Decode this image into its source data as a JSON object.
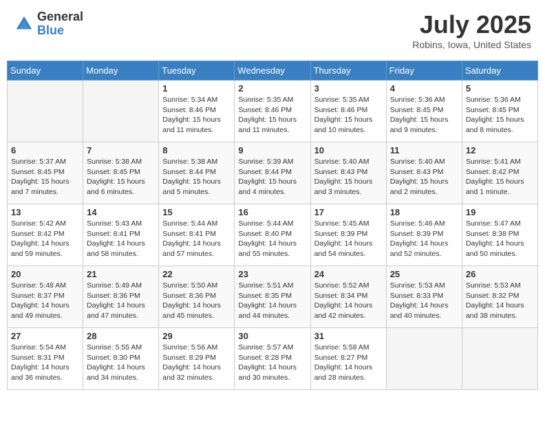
{
  "header": {
    "logo_general": "General",
    "logo_blue": "Blue",
    "title": "July 2025",
    "location": "Robins, Iowa, United States"
  },
  "days_of_week": [
    "Sunday",
    "Monday",
    "Tuesday",
    "Wednesday",
    "Thursday",
    "Friday",
    "Saturday"
  ],
  "weeks": [
    [
      {
        "day": "",
        "info": ""
      },
      {
        "day": "",
        "info": ""
      },
      {
        "day": "1",
        "info": "Sunrise: 5:34 AM\nSunset: 8:46 PM\nDaylight: 15 hours\nand 11 minutes."
      },
      {
        "day": "2",
        "info": "Sunrise: 5:35 AM\nSunset: 8:46 PM\nDaylight: 15 hours\nand 11 minutes."
      },
      {
        "day": "3",
        "info": "Sunrise: 5:35 AM\nSunset: 8:46 PM\nDaylight: 15 hours\nand 10 minutes."
      },
      {
        "day": "4",
        "info": "Sunrise: 5:36 AM\nSunset: 8:45 PM\nDaylight: 15 hours\nand 9 minutes."
      },
      {
        "day": "5",
        "info": "Sunrise: 5:36 AM\nSunset: 8:45 PM\nDaylight: 15 hours\nand 8 minutes."
      }
    ],
    [
      {
        "day": "6",
        "info": "Sunrise: 5:37 AM\nSunset: 8:45 PM\nDaylight: 15 hours\nand 7 minutes."
      },
      {
        "day": "7",
        "info": "Sunrise: 5:38 AM\nSunset: 8:45 PM\nDaylight: 15 hours\nand 6 minutes."
      },
      {
        "day": "8",
        "info": "Sunrise: 5:38 AM\nSunset: 8:44 PM\nDaylight: 15 hours\nand 5 minutes."
      },
      {
        "day": "9",
        "info": "Sunrise: 5:39 AM\nSunset: 8:44 PM\nDaylight: 15 hours\nand 4 minutes."
      },
      {
        "day": "10",
        "info": "Sunrise: 5:40 AM\nSunset: 8:43 PM\nDaylight: 15 hours\nand 3 minutes."
      },
      {
        "day": "11",
        "info": "Sunrise: 5:40 AM\nSunset: 8:43 PM\nDaylight: 15 hours\nand 2 minutes."
      },
      {
        "day": "12",
        "info": "Sunrise: 5:41 AM\nSunset: 8:42 PM\nDaylight: 15 hours\nand 1 minute."
      }
    ],
    [
      {
        "day": "13",
        "info": "Sunrise: 5:42 AM\nSunset: 8:42 PM\nDaylight: 14 hours\nand 59 minutes."
      },
      {
        "day": "14",
        "info": "Sunrise: 5:43 AM\nSunset: 8:41 PM\nDaylight: 14 hours\nand 58 minutes."
      },
      {
        "day": "15",
        "info": "Sunrise: 5:44 AM\nSunset: 8:41 PM\nDaylight: 14 hours\nand 57 minutes."
      },
      {
        "day": "16",
        "info": "Sunrise: 5:44 AM\nSunset: 8:40 PM\nDaylight: 14 hours\nand 55 minutes."
      },
      {
        "day": "17",
        "info": "Sunrise: 5:45 AM\nSunset: 8:39 PM\nDaylight: 14 hours\nand 54 minutes."
      },
      {
        "day": "18",
        "info": "Sunrise: 5:46 AM\nSunset: 8:39 PM\nDaylight: 14 hours\nand 52 minutes."
      },
      {
        "day": "19",
        "info": "Sunrise: 5:47 AM\nSunset: 8:38 PM\nDaylight: 14 hours\nand 50 minutes."
      }
    ],
    [
      {
        "day": "20",
        "info": "Sunrise: 5:48 AM\nSunset: 8:37 PM\nDaylight: 14 hours\nand 49 minutes."
      },
      {
        "day": "21",
        "info": "Sunrise: 5:49 AM\nSunset: 8:36 PM\nDaylight: 14 hours\nand 47 minutes."
      },
      {
        "day": "22",
        "info": "Sunrise: 5:50 AM\nSunset: 8:36 PM\nDaylight: 14 hours\nand 45 minutes."
      },
      {
        "day": "23",
        "info": "Sunrise: 5:51 AM\nSunset: 8:35 PM\nDaylight: 14 hours\nand 44 minutes."
      },
      {
        "day": "24",
        "info": "Sunrise: 5:52 AM\nSunset: 8:34 PM\nDaylight: 14 hours\nand 42 minutes."
      },
      {
        "day": "25",
        "info": "Sunrise: 5:53 AM\nSunset: 8:33 PM\nDaylight: 14 hours\nand 40 minutes."
      },
      {
        "day": "26",
        "info": "Sunrise: 5:53 AM\nSunset: 8:32 PM\nDaylight: 14 hours\nand 38 minutes."
      }
    ],
    [
      {
        "day": "27",
        "info": "Sunrise: 5:54 AM\nSunset: 8:31 PM\nDaylight: 14 hours\nand 36 minutes."
      },
      {
        "day": "28",
        "info": "Sunrise: 5:55 AM\nSunset: 8:30 PM\nDaylight: 14 hours\nand 34 minutes."
      },
      {
        "day": "29",
        "info": "Sunrise: 5:56 AM\nSunset: 8:29 PM\nDaylight: 14 hours\nand 32 minutes."
      },
      {
        "day": "30",
        "info": "Sunrise: 5:57 AM\nSunset: 8:28 PM\nDaylight: 14 hours\nand 30 minutes."
      },
      {
        "day": "31",
        "info": "Sunrise: 5:58 AM\nSunset: 8:27 PM\nDaylight: 14 hours\nand 28 minutes."
      },
      {
        "day": "",
        "info": ""
      },
      {
        "day": "",
        "info": ""
      }
    ]
  ]
}
